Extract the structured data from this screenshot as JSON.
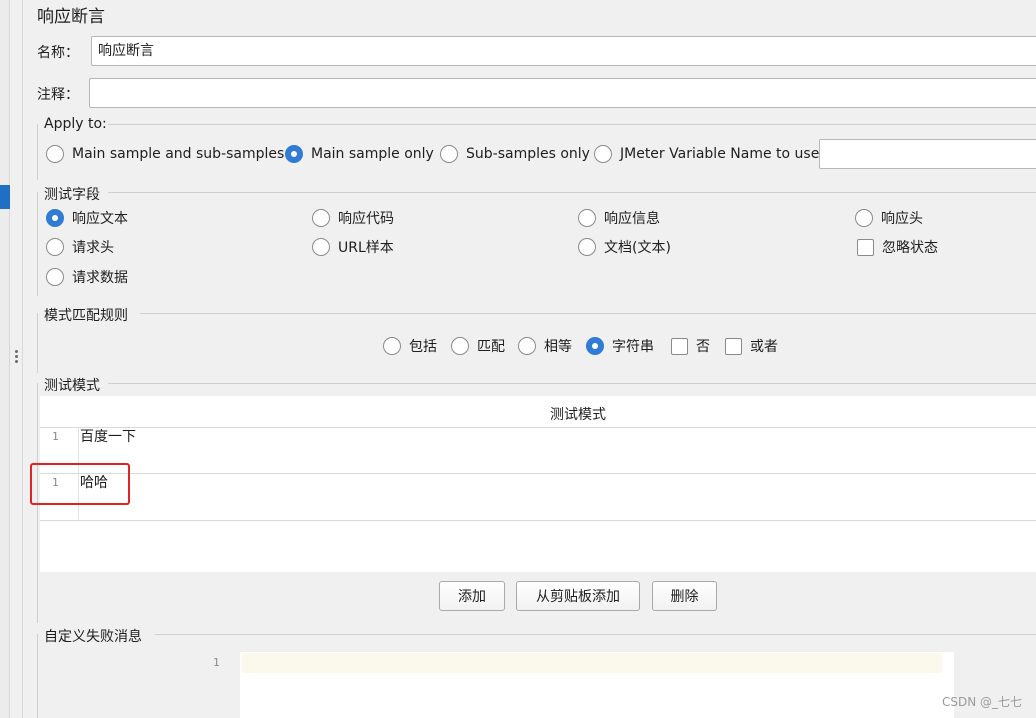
{
  "panel_title": "响应断言",
  "name_field": {
    "label": "名称：",
    "value": "响应断言"
  },
  "comment_field": {
    "label": "注释：",
    "value": ""
  },
  "apply_to": {
    "title": "Apply to:",
    "options": [
      {
        "label": "Main sample and sub-samples",
        "selected": false
      },
      {
        "label": "Main sample only",
        "selected": true
      },
      {
        "label": "Sub-samples only",
        "selected": false
      },
      {
        "label": "JMeter Variable Name to use",
        "selected": false
      }
    ],
    "variable_value": ""
  },
  "test_field": {
    "title": "测试字段",
    "options": [
      {
        "label": "响应文本",
        "selected": true
      },
      {
        "label": "响应代码",
        "selected": false
      },
      {
        "label": "响应信息",
        "selected": false
      },
      {
        "label": "响应头",
        "selected": false
      },
      {
        "label": "请求头",
        "selected": false
      },
      {
        "label": "URL样本",
        "selected": false
      },
      {
        "label": "文档(文本)",
        "selected": false
      },
      {
        "label": "请求数据",
        "selected": false
      }
    ],
    "ignore_status": {
      "label": "忽略状态",
      "checked": false
    }
  },
  "pattern_rules": {
    "title": "模式匹配规则",
    "radios": [
      {
        "label": "包括",
        "selected": false
      },
      {
        "label": "匹配",
        "selected": false
      },
      {
        "label": "相等",
        "selected": false
      },
      {
        "label": "字符串",
        "selected": true
      }
    ],
    "checks": [
      {
        "label": "否",
        "checked": false
      },
      {
        "label": "或者",
        "checked": false
      }
    ]
  },
  "test_patterns": {
    "title": "测试模式",
    "column_header": "测试模式",
    "rows": [
      {
        "line": "1",
        "text": "百度一下"
      },
      {
        "line": "1",
        "text": "哈哈"
      }
    ]
  },
  "buttons": {
    "add": "添加",
    "add_clipboard": "从剪贴板添加",
    "delete": "删除"
  },
  "custom_failure": {
    "title": "自定义失败消息",
    "line": "1"
  },
  "watermark": "CSDN @_七七",
  "colors": {
    "accent": "#2f7bd6",
    "highlight": "#e02424"
  }
}
